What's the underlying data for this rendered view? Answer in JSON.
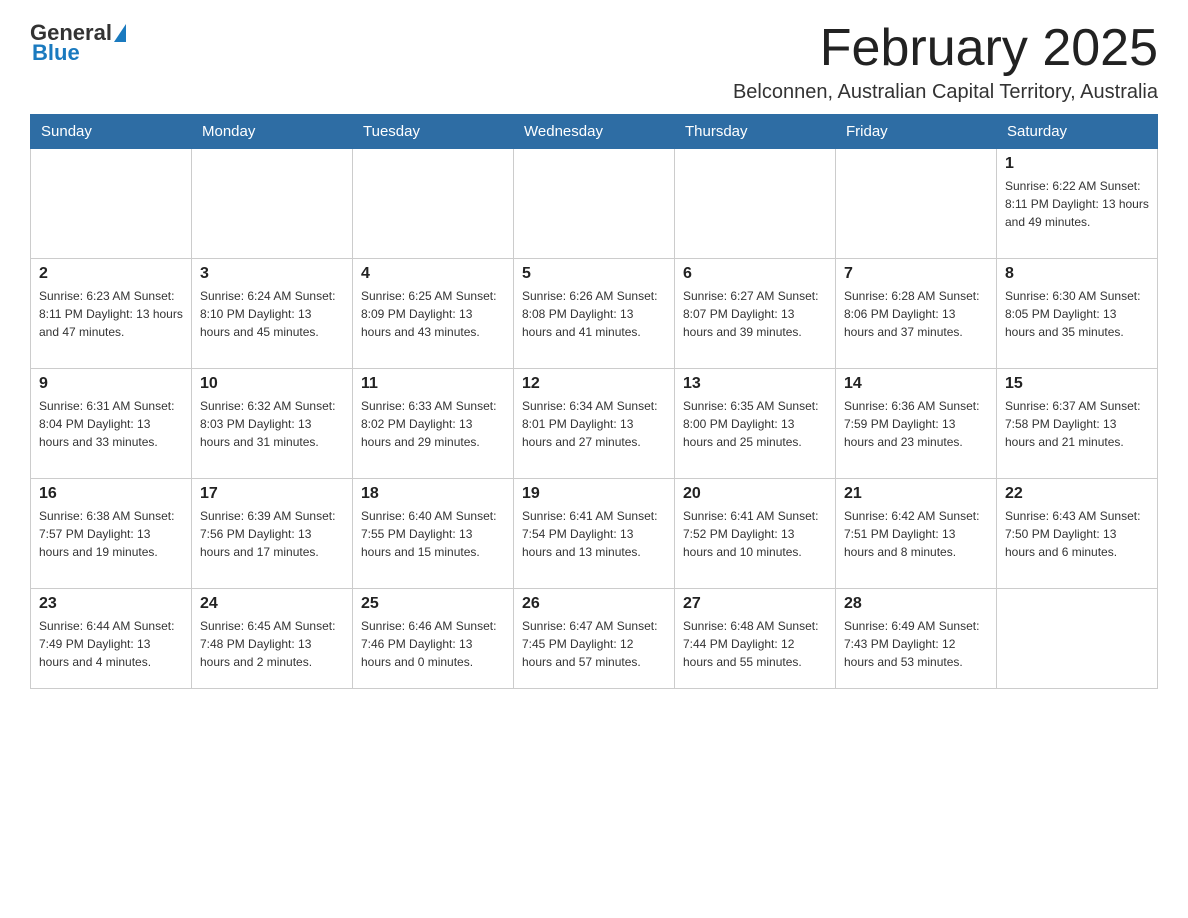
{
  "logo": {
    "general": "General",
    "blue": "Blue"
  },
  "title": "February 2025",
  "subtitle": "Belconnen, Australian Capital Territory, Australia",
  "days_of_week": [
    "Sunday",
    "Monday",
    "Tuesday",
    "Wednesday",
    "Thursday",
    "Friday",
    "Saturday"
  ],
  "weeks": [
    [
      {
        "day": "",
        "info": ""
      },
      {
        "day": "",
        "info": ""
      },
      {
        "day": "",
        "info": ""
      },
      {
        "day": "",
        "info": ""
      },
      {
        "day": "",
        "info": ""
      },
      {
        "day": "",
        "info": ""
      },
      {
        "day": "1",
        "info": "Sunrise: 6:22 AM\nSunset: 8:11 PM\nDaylight: 13 hours and 49 minutes."
      }
    ],
    [
      {
        "day": "2",
        "info": "Sunrise: 6:23 AM\nSunset: 8:11 PM\nDaylight: 13 hours and 47 minutes."
      },
      {
        "day": "3",
        "info": "Sunrise: 6:24 AM\nSunset: 8:10 PM\nDaylight: 13 hours and 45 minutes."
      },
      {
        "day": "4",
        "info": "Sunrise: 6:25 AM\nSunset: 8:09 PM\nDaylight: 13 hours and 43 minutes."
      },
      {
        "day": "5",
        "info": "Sunrise: 6:26 AM\nSunset: 8:08 PM\nDaylight: 13 hours and 41 minutes."
      },
      {
        "day": "6",
        "info": "Sunrise: 6:27 AM\nSunset: 8:07 PM\nDaylight: 13 hours and 39 minutes."
      },
      {
        "day": "7",
        "info": "Sunrise: 6:28 AM\nSunset: 8:06 PM\nDaylight: 13 hours and 37 minutes."
      },
      {
        "day": "8",
        "info": "Sunrise: 6:30 AM\nSunset: 8:05 PM\nDaylight: 13 hours and 35 minutes."
      }
    ],
    [
      {
        "day": "9",
        "info": "Sunrise: 6:31 AM\nSunset: 8:04 PM\nDaylight: 13 hours and 33 minutes."
      },
      {
        "day": "10",
        "info": "Sunrise: 6:32 AM\nSunset: 8:03 PM\nDaylight: 13 hours and 31 minutes."
      },
      {
        "day": "11",
        "info": "Sunrise: 6:33 AM\nSunset: 8:02 PM\nDaylight: 13 hours and 29 minutes."
      },
      {
        "day": "12",
        "info": "Sunrise: 6:34 AM\nSunset: 8:01 PM\nDaylight: 13 hours and 27 minutes."
      },
      {
        "day": "13",
        "info": "Sunrise: 6:35 AM\nSunset: 8:00 PM\nDaylight: 13 hours and 25 minutes."
      },
      {
        "day": "14",
        "info": "Sunrise: 6:36 AM\nSunset: 7:59 PM\nDaylight: 13 hours and 23 minutes."
      },
      {
        "day": "15",
        "info": "Sunrise: 6:37 AM\nSunset: 7:58 PM\nDaylight: 13 hours and 21 minutes."
      }
    ],
    [
      {
        "day": "16",
        "info": "Sunrise: 6:38 AM\nSunset: 7:57 PM\nDaylight: 13 hours and 19 minutes."
      },
      {
        "day": "17",
        "info": "Sunrise: 6:39 AM\nSunset: 7:56 PM\nDaylight: 13 hours and 17 minutes."
      },
      {
        "day": "18",
        "info": "Sunrise: 6:40 AM\nSunset: 7:55 PM\nDaylight: 13 hours and 15 minutes."
      },
      {
        "day": "19",
        "info": "Sunrise: 6:41 AM\nSunset: 7:54 PM\nDaylight: 13 hours and 13 minutes."
      },
      {
        "day": "20",
        "info": "Sunrise: 6:41 AM\nSunset: 7:52 PM\nDaylight: 13 hours and 10 minutes."
      },
      {
        "day": "21",
        "info": "Sunrise: 6:42 AM\nSunset: 7:51 PM\nDaylight: 13 hours and 8 minutes."
      },
      {
        "day": "22",
        "info": "Sunrise: 6:43 AM\nSunset: 7:50 PM\nDaylight: 13 hours and 6 minutes."
      }
    ],
    [
      {
        "day": "23",
        "info": "Sunrise: 6:44 AM\nSunset: 7:49 PM\nDaylight: 13 hours and 4 minutes."
      },
      {
        "day": "24",
        "info": "Sunrise: 6:45 AM\nSunset: 7:48 PM\nDaylight: 13 hours and 2 minutes."
      },
      {
        "day": "25",
        "info": "Sunrise: 6:46 AM\nSunset: 7:46 PM\nDaylight: 13 hours and 0 minutes."
      },
      {
        "day": "26",
        "info": "Sunrise: 6:47 AM\nSunset: 7:45 PM\nDaylight: 12 hours and 57 minutes."
      },
      {
        "day": "27",
        "info": "Sunrise: 6:48 AM\nSunset: 7:44 PM\nDaylight: 12 hours and 55 minutes."
      },
      {
        "day": "28",
        "info": "Sunrise: 6:49 AM\nSunset: 7:43 PM\nDaylight: 12 hours and 53 minutes."
      },
      {
        "day": "",
        "info": ""
      }
    ]
  ]
}
